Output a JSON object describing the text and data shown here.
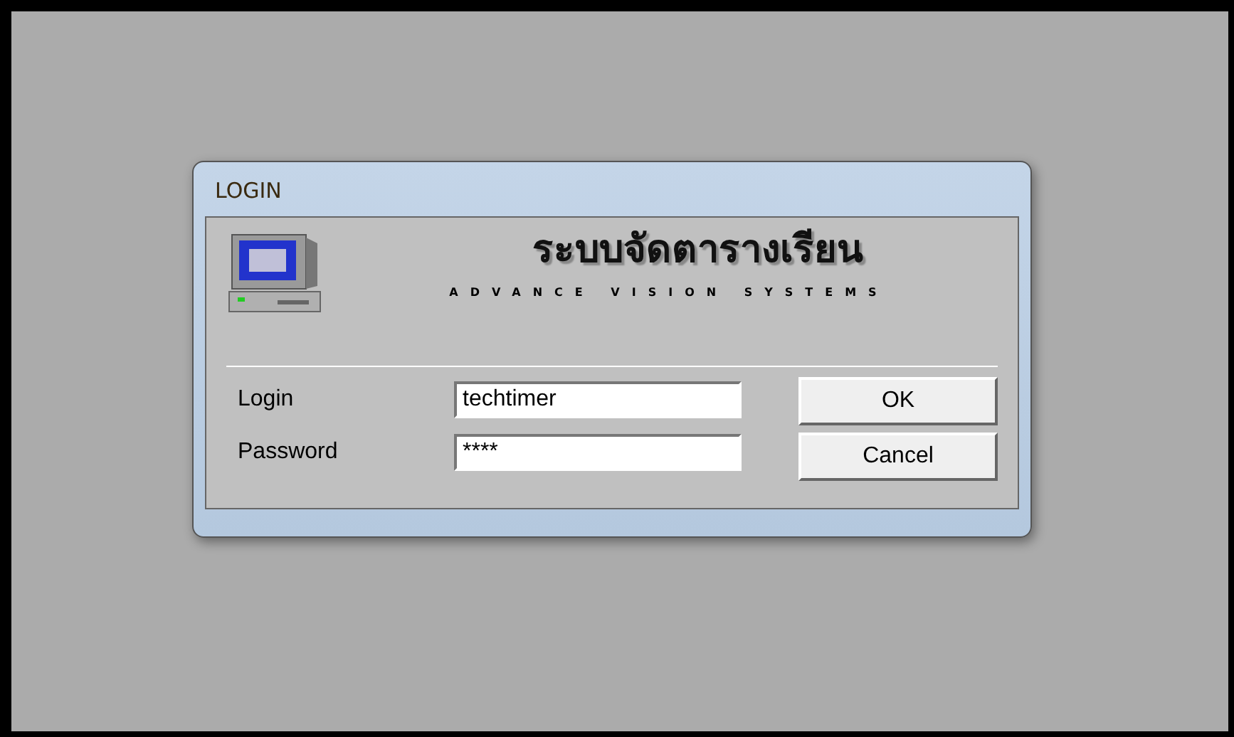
{
  "window": {
    "title": "LOGIN"
  },
  "header": {
    "title": "ระบบจัดตารางเรียน",
    "subtitle": "ADVANCE VISION SYSTEMS"
  },
  "fields": [
    {
      "label": "Login",
      "value": "techtimer"
    },
    {
      "label": "Password",
      "value": "****"
    }
  ],
  "buttons": [
    "OK",
    "Cancel"
  ]
}
